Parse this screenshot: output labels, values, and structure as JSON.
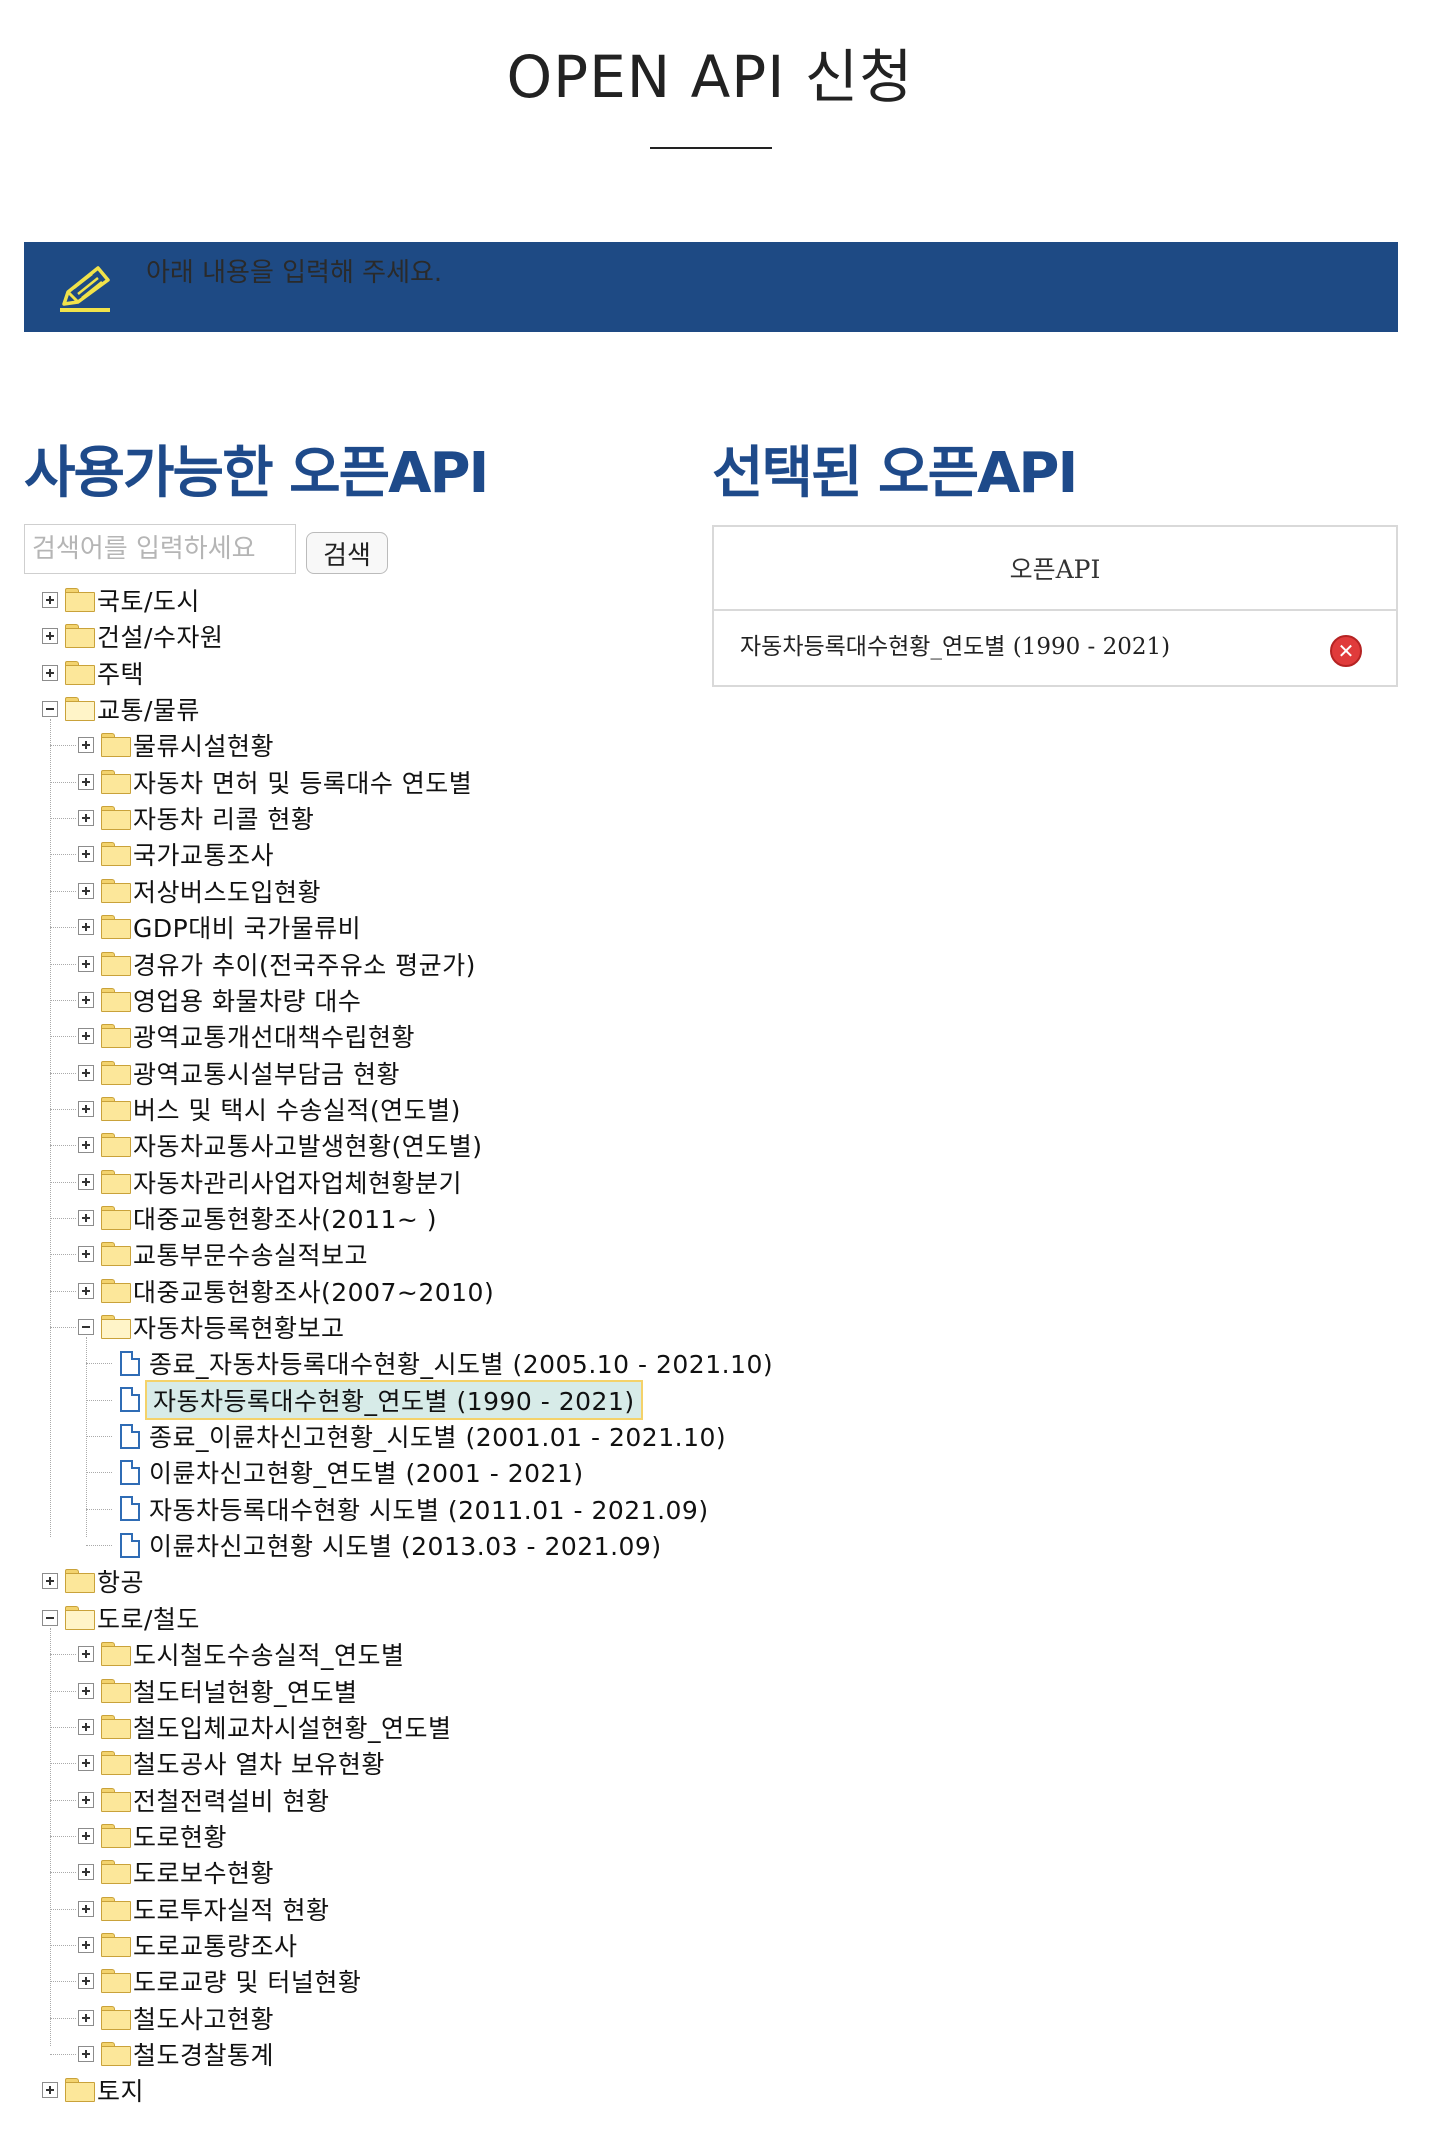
{
  "page": {
    "title": "OPEN API 신청"
  },
  "notice": {
    "text": "아래 내용을 입력해 주세요.",
    "icon": "pencil-icon"
  },
  "available": {
    "heading": "사용가능한 오픈API",
    "search_placeholder": "검색어를 입력하세요",
    "search_button": "검색"
  },
  "selected": {
    "heading": "선택된 오픈API",
    "column_header": "오픈API",
    "rows": [
      {
        "label": "자동차등록대수현황_연도별 (1990 - 2021)"
      }
    ]
  },
  "tree": [
    {
      "label": "국토/도시",
      "type": "folder",
      "state": "collapsed"
    },
    {
      "label": "건설/수자원",
      "type": "folder",
      "state": "collapsed"
    },
    {
      "label": "주택",
      "type": "folder",
      "state": "collapsed"
    },
    {
      "label": "교통/물류",
      "type": "folder",
      "state": "expanded",
      "children": [
        {
          "label": "물류시설현황",
          "type": "folder",
          "state": "collapsed"
        },
        {
          "label": "자동차 면허 및 등록대수 연도별",
          "type": "folder",
          "state": "collapsed"
        },
        {
          "label": "자동차 리콜 현황",
          "type": "folder",
          "state": "collapsed"
        },
        {
          "label": "국가교통조사",
          "type": "folder",
          "state": "collapsed"
        },
        {
          "label": "저상버스도입현황",
          "type": "folder",
          "state": "collapsed"
        },
        {
          "label": "GDP대비 국가물류비",
          "type": "folder",
          "state": "collapsed"
        },
        {
          "label": "경유가 추이(전국주유소 평균가)",
          "type": "folder",
          "state": "collapsed"
        },
        {
          "label": "영업용 화물차량 대수",
          "type": "folder",
          "state": "collapsed"
        },
        {
          "label": "광역교통개선대책수립현황",
          "type": "folder",
          "state": "collapsed"
        },
        {
          "label": "광역교통시설부담금 현황",
          "type": "folder",
          "state": "collapsed"
        },
        {
          "label": "버스 및 택시 수송실적(연도별)",
          "type": "folder",
          "state": "collapsed"
        },
        {
          "label": "자동차교통사고발생현황(연도별)",
          "type": "folder",
          "state": "collapsed"
        },
        {
          "label": "자동차관리사업자업체현황분기",
          "type": "folder",
          "state": "collapsed"
        },
        {
          "label": "대중교통현황조사(2011~ )",
          "type": "folder",
          "state": "collapsed"
        },
        {
          "label": "교통부문수송실적보고",
          "type": "folder",
          "state": "collapsed"
        },
        {
          "label": "대중교통현황조사(2007~2010)",
          "type": "folder",
          "state": "collapsed"
        },
        {
          "label": "자동차등록현황보고",
          "type": "folder",
          "state": "expanded",
          "children": [
            {
              "label": "종료_자동차등록대수현황_시도별 (2005.10 - 2021.10)",
              "type": "doc"
            },
            {
              "label": "자동차등록대수현황_연도별 (1990 - 2021)",
              "type": "doc",
              "selected": true
            },
            {
              "label": "종료_이륜차신고현황_시도별 (2001.01 - 2021.10)",
              "type": "doc"
            },
            {
              "label": "이륜차신고현황_연도별 (2001 - 2021)",
              "type": "doc"
            },
            {
              "label": "자동차등록대수현황 시도별 (2011.01 - 2021.09)",
              "type": "doc"
            },
            {
              "label": "이륜차신고현황 시도별 (2013.03 - 2021.09)",
              "type": "doc"
            }
          ]
        }
      ]
    },
    {
      "label": "항공",
      "type": "folder",
      "state": "collapsed"
    },
    {
      "label": "도로/철도",
      "type": "folder",
      "state": "expanded",
      "children": [
        {
          "label": "도시철도수송실적_연도별",
          "type": "folder",
          "state": "collapsed"
        },
        {
          "label": "철도터널현황_연도별",
          "type": "folder",
          "state": "collapsed"
        },
        {
          "label": "철도입체교차시설현황_연도별",
          "type": "folder",
          "state": "collapsed"
        },
        {
          "label": "철도공사 열차 보유현황",
          "type": "folder",
          "state": "collapsed"
        },
        {
          "label": "전철전력설비 현황",
          "type": "folder",
          "state": "collapsed"
        },
        {
          "label": "도로현황",
          "type": "folder",
          "state": "collapsed"
        },
        {
          "label": "도로보수현황",
          "type": "folder",
          "state": "collapsed"
        },
        {
          "label": "도로투자실적 현황",
          "type": "folder",
          "state": "collapsed"
        },
        {
          "label": "도로교통량조사",
          "type": "folder",
          "state": "collapsed"
        },
        {
          "label": "도로교량 및 터널현황",
          "type": "folder",
          "state": "collapsed"
        },
        {
          "label": "철도사고현황",
          "type": "folder",
          "state": "collapsed"
        },
        {
          "label": "철도경찰통계",
          "type": "folder",
          "state": "collapsed"
        }
      ]
    },
    {
      "label": "토지",
      "type": "folder",
      "state": "collapsed"
    }
  ]
}
